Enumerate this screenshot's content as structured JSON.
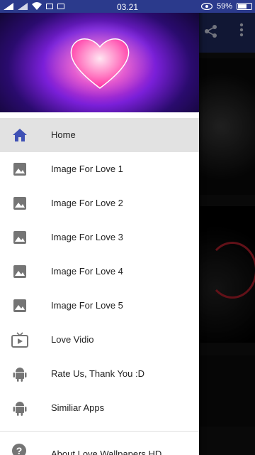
{
  "status_bar": {
    "time": "03.21",
    "battery_percent": "59%",
    "battery_level": 0.59
  },
  "toolbar": {
    "share_icon": "share-icon",
    "more_icon": "more-vert-icon"
  },
  "drawer": {
    "header_image": "glowing-heart-wallpaper",
    "items": [
      {
        "label": "Home",
        "icon": "home-icon",
        "active": true
      },
      {
        "label": "Image For Love 1",
        "icon": "image-icon"
      },
      {
        "label": "Image For Love 2",
        "icon": "image-icon"
      },
      {
        "label": "Image For Love 3",
        "icon": "image-icon"
      },
      {
        "label": "Image For Love 4",
        "icon": "image-icon"
      },
      {
        "label": "Image For Love 5",
        "icon": "image-icon"
      },
      {
        "label": "Love Vidio",
        "icon": "tv-icon"
      },
      {
        "label": "Rate Us, Thank You :D",
        "icon": "android-icon"
      },
      {
        "label": "Similiar Apps",
        "icon": "android-icon"
      }
    ],
    "about": {
      "label": "About Love Wallpapers HD",
      "icon": "help-icon"
    }
  },
  "colors": {
    "status_bar": "#2b3a8c",
    "home_icon": "#3f51b5",
    "icon_gray": "#757575",
    "active_bg": "#e2e2e2"
  }
}
